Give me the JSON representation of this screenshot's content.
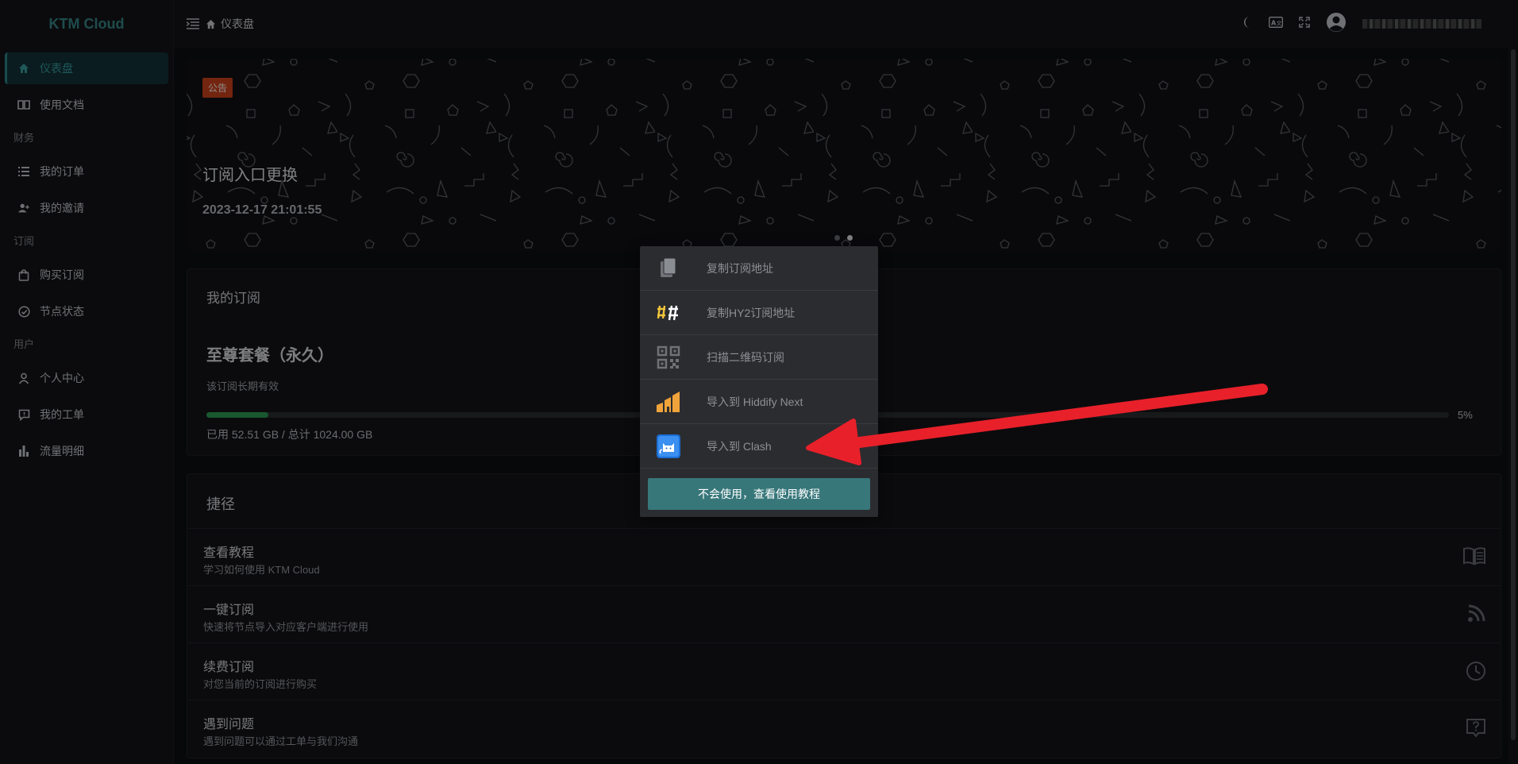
{
  "app": {
    "title": "KTM Cloud"
  },
  "sidebar": {
    "items": [
      {
        "label": "仪表盘",
        "icon": "home-icon",
        "active": true
      },
      {
        "label": "使用文档",
        "icon": "book-icon"
      },
      {
        "section": "财务"
      },
      {
        "label": "我的订单",
        "icon": "list-icon"
      },
      {
        "label": "我的邀请",
        "icon": "users-icon"
      },
      {
        "section": "订阅"
      },
      {
        "label": "购买订阅",
        "icon": "bag-icon"
      },
      {
        "label": "节点状态",
        "icon": "check-circle-icon"
      },
      {
        "section": "用户"
      },
      {
        "label": "个人中心",
        "icon": "user-icon"
      },
      {
        "label": "我的工单",
        "icon": "ticket-icon"
      },
      {
        "label": "流量明细",
        "icon": "bar-chart-icon"
      }
    ]
  },
  "header": {
    "breadcrumb": "仪表盘"
  },
  "banner": {
    "badge": "公告",
    "title": "订阅入口更换",
    "date": "2023-12-17 21:01:55"
  },
  "subscription": {
    "card_title": "我的订阅",
    "plan": "至尊套餐（永久）",
    "note": "该订阅长期有效",
    "progress_percent": 5,
    "percent_label": "5%",
    "usage": "已用 52.51 GB / 总计 1024.00 GB"
  },
  "shortcuts": {
    "card_title": "捷径",
    "rows": [
      {
        "title": "查看教程",
        "desc": "学习如何使用 KTM Cloud",
        "icon": "book-open-icon"
      },
      {
        "title": "一键订阅",
        "desc": "快速将节点导入对应客户端进行使用",
        "icon": "rss-icon"
      },
      {
        "title": "续费订阅",
        "desc": "对您当前的订阅进行购买",
        "icon": "clock-icon"
      },
      {
        "title": "遇到问题",
        "desc": "遇到问题可以通过工单与我们沟通",
        "icon": "help-chat-icon"
      }
    ]
  },
  "popup": {
    "items": [
      {
        "label": "复制订阅地址",
        "icon": "copy-icon"
      },
      {
        "label": "复制HY2订阅地址",
        "icon": "hy2-icon"
      },
      {
        "label": "扫描二维码订阅",
        "icon": "qrcode-icon"
      },
      {
        "label": "导入到 Hiddify Next",
        "icon": "hiddify-icon"
      },
      {
        "label": "导入到 Clash",
        "icon": "clash-cat-icon"
      }
    ],
    "button": "不会使用，查看使用教程"
  },
  "colors": {
    "accent": "#37777a",
    "progress": "#2f9e56",
    "badge": "#d4441c",
    "arrow": "#e8202a"
  }
}
